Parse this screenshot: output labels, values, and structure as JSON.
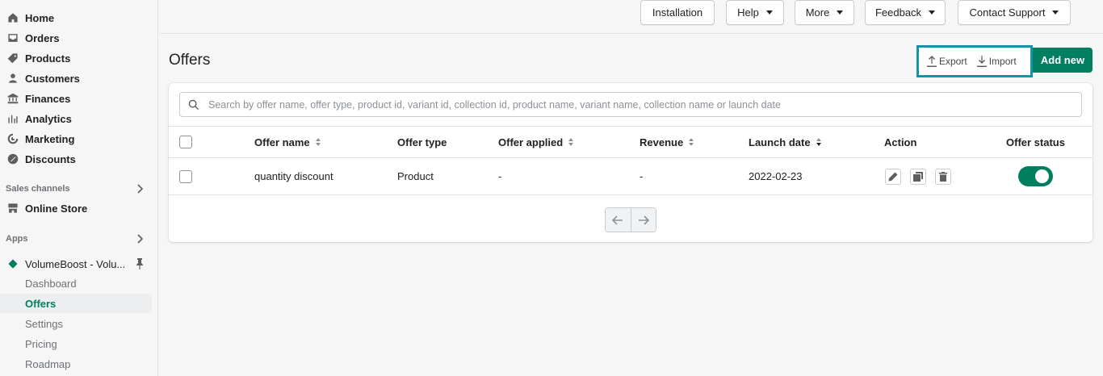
{
  "sidebar": {
    "main_items": [
      {
        "label": "Home",
        "icon": "home-icon"
      },
      {
        "label": "Orders",
        "icon": "orders-icon"
      },
      {
        "label": "Products",
        "icon": "tag-icon"
      },
      {
        "label": "Customers",
        "icon": "person-icon"
      },
      {
        "label": "Finances",
        "icon": "bank-icon"
      },
      {
        "label": "Analytics",
        "icon": "bar-chart-icon"
      },
      {
        "label": "Marketing",
        "icon": "target-icon"
      },
      {
        "label": "Discounts",
        "icon": "discount-icon"
      }
    ],
    "sales_channels_label": "Sales channels",
    "online_store_label": "Online Store",
    "apps_label": "Apps",
    "app_name": "VolumeBoost - Volu...",
    "app_items": [
      {
        "label": "Dashboard",
        "active": false
      },
      {
        "label": "Offers",
        "active": true
      },
      {
        "label": "Settings",
        "active": false
      },
      {
        "label": "Pricing",
        "active": false
      },
      {
        "label": "Roadmap",
        "active": false
      }
    ]
  },
  "topbar": {
    "installation": "Installation",
    "help": "Help",
    "more": "More",
    "feedback": "Feedback",
    "contact_support": "Contact Support"
  },
  "page": {
    "title": "Offers",
    "export_label": "Export",
    "import_label": "Import",
    "add_new_label": "Add new"
  },
  "search": {
    "placeholder": "Search by offer name, offer type, product id, variant id, collection id, product name, variant name, collection name or launch date",
    "value": ""
  },
  "table": {
    "headers": {
      "offer_name": "Offer name",
      "offer_type": "Offer type",
      "offer_applied": "Offer applied",
      "revenue": "Revenue",
      "launch_date": "Launch date",
      "action": "Action",
      "offer_status": "Offer status"
    },
    "rows": [
      {
        "offer_name": "quantity discount",
        "offer_type": "Product",
        "offer_applied": "-",
        "revenue": "-",
        "launch_date": "2022-02-23",
        "status_on": true
      }
    ]
  },
  "colors": {
    "primary": "#008060",
    "highlight_box": "#1494a8",
    "toggle_on": "#007f5f"
  }
}
